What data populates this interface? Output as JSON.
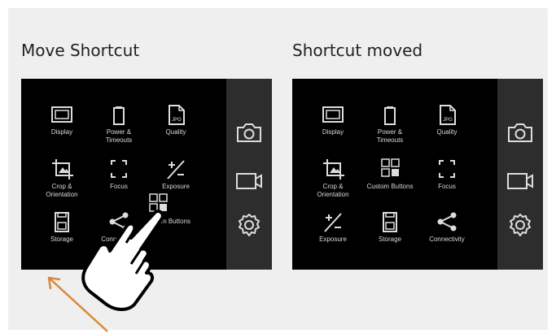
{
  "left_panel": {
    "caption": "Move Shortcut",
    "tiles": [
      {
        "label": "Display",
        "icon": "display-icon"
      },
      {
        "label": "Power &\nTimeouts",
        "icon": "battery-icon"
      },
      {
        "label": "Quality",
        "icon": "jpg-file-icon",
        "badge": "JPG"
      },
      {
        "label": "Crop &\nOrientation",
        "icon": "crop-icon"
      },
      {
        "label": "Focus",
        "icon": "focus-icon"
      },
      {
        "label": "Exposure",
        "icon": "exposure-icon"
      },
      {
        "label": "Storage",
        "icon": "storage-icon"
      },
      {
        "label": "Connectivity",
        "icon": "share-icon"
      },
      {
        "label": "m Buttons",
        "icon": "custom-buttons-icon"
      }
    ]
  },
  "right_panel": {
    "caption": "Shortcut moved",
    "tiles": [
      {
        "label": "Display",
        "icon": "display-icon"
      },
      {
        "label": "Power &\nTimeouts",
        "icon": "battery-icon"
      },
      {
        "label": "Quality",
        "icon": "jpg-file-icon",
        "badge": "JPG"
      },
      {
        "label": "Crop &\nOrientation",
        "icon": "crop-icon"
      },
      {
        "label": "Custom Buttons",
        "icon": "custom-buttons-icon"
      },
      {
        "label": "Focus",
        "icon": "focus-icon"
      },
      {
        "label": "Exposure",
        "icon": "exposure-icon"
      },
      {
        "label": "Storage",
        "icon": "storage-icon"
      },
      {
        "label": "Connectivity",
        "icon": "share-icon"
      }
    ]
  },
  "sidebar": {
    "buttons": [
      {
        "icon": "camera-icon"
      },
      {
        "icon": "video-camera-icon"
      },
      {
        "icon": "settings-gear-icon"
      }
    ]
  },
  "annotations": {
    "hand_icon": "pointing-hand-icon",
    "arrow_icon": "drag-arrow-icon",
    "arrow_color": "#d9893a"
  }
}
